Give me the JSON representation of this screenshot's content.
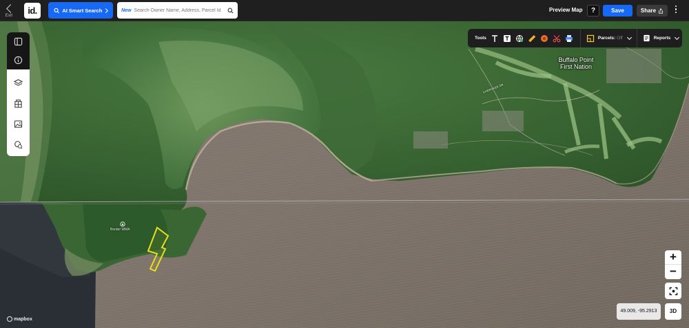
{
  "topbar": {
    "exit_label": "Exit",
    "logo_text": "id.",
    "ai_search_label": "AI Smart Search",
    "search_badge": "New",
    "search_placeholder": "Search Owner Name, Address, Parcel Id",
    "preview_label": "Preview Map",
    "help_label": "?",
    "save_label": "Save",
    "share_label": "Share"
  },
  "tools": {
    "label": "Tools",
    "icons": [
      "text-icon",
      "text-box-icon",
      "globe-pin-icon",
      "ruler-icon",
      "buffer-icon",
      "scissors-icon",
      "print-icon"
    ],
    "parcels_label": "Parcels:",
    "parcels_state": "Off",
    "reports_label": "Reports"
  },
  "map": {
    "place_label_1": "Buffalo Point",
    "place_label_2": "First Nation",
    "road_label": "CHEROKEE DR",
    "poi_label": "Border WMA",
    "coordinates": "49.009, -95.2913",
    "attribution": "mapbox",
    "zoom_in": "+",
    "zoom_out": "−",
    "mode_3d": "3D"
  },
  "colors": {
    "accent": "#1769f5",
    "parcel_outline": "#e6e01f"
  }
}
